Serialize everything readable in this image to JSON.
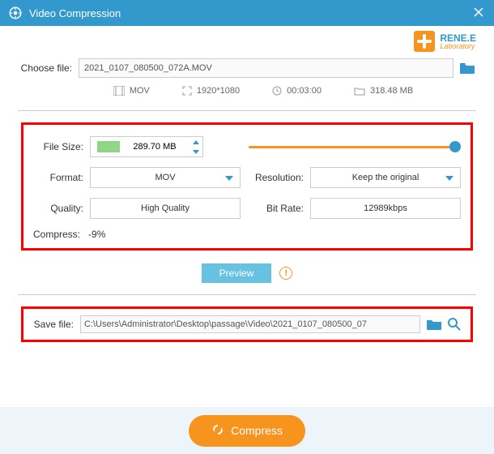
{
  "titlebar": {
    "title": "Video Compression"
  },
  "brand": {
    "name": "RENE.E",
    "sub": "Laboratory"
  },
  "choose": {
    "label": "Choose file:",
    "filename": "2021_0107_080500_072A.MOV"
  },
  "meta": {
    "format": "MOV",
    "resolution": "1920*1080",
    "duration": "00:03:00",
    "size": "318.48 MB"
  },
  "settings": {
    "filesize_label": "File Size:",
    "filesize_value": "289.70 MB",
    "format_label": "Format:",
    "format_value": "MOV",
    "resolution_label": "Resolution:",
    "resolution_value": "Keep the original",
    "quality_label": "Quality:",
    "quality_value": "High Quality",
    "bitrate_label": "Bit Rate:",
    "bitrate_value": "12989kbps",
    "compress_label": "Compress:",
    "compress_value": "-9%"
  },
  "preview": {
    "label": "Preview"
  },
  "save": {
    "label": "Save file:",
    "path": "C:\\Users\\Administrator\\Desktop\\passage\\Video\\2021_0107_080500_07"
  },
  "footer": {
    "compress_label": "Compress"
  }
}
